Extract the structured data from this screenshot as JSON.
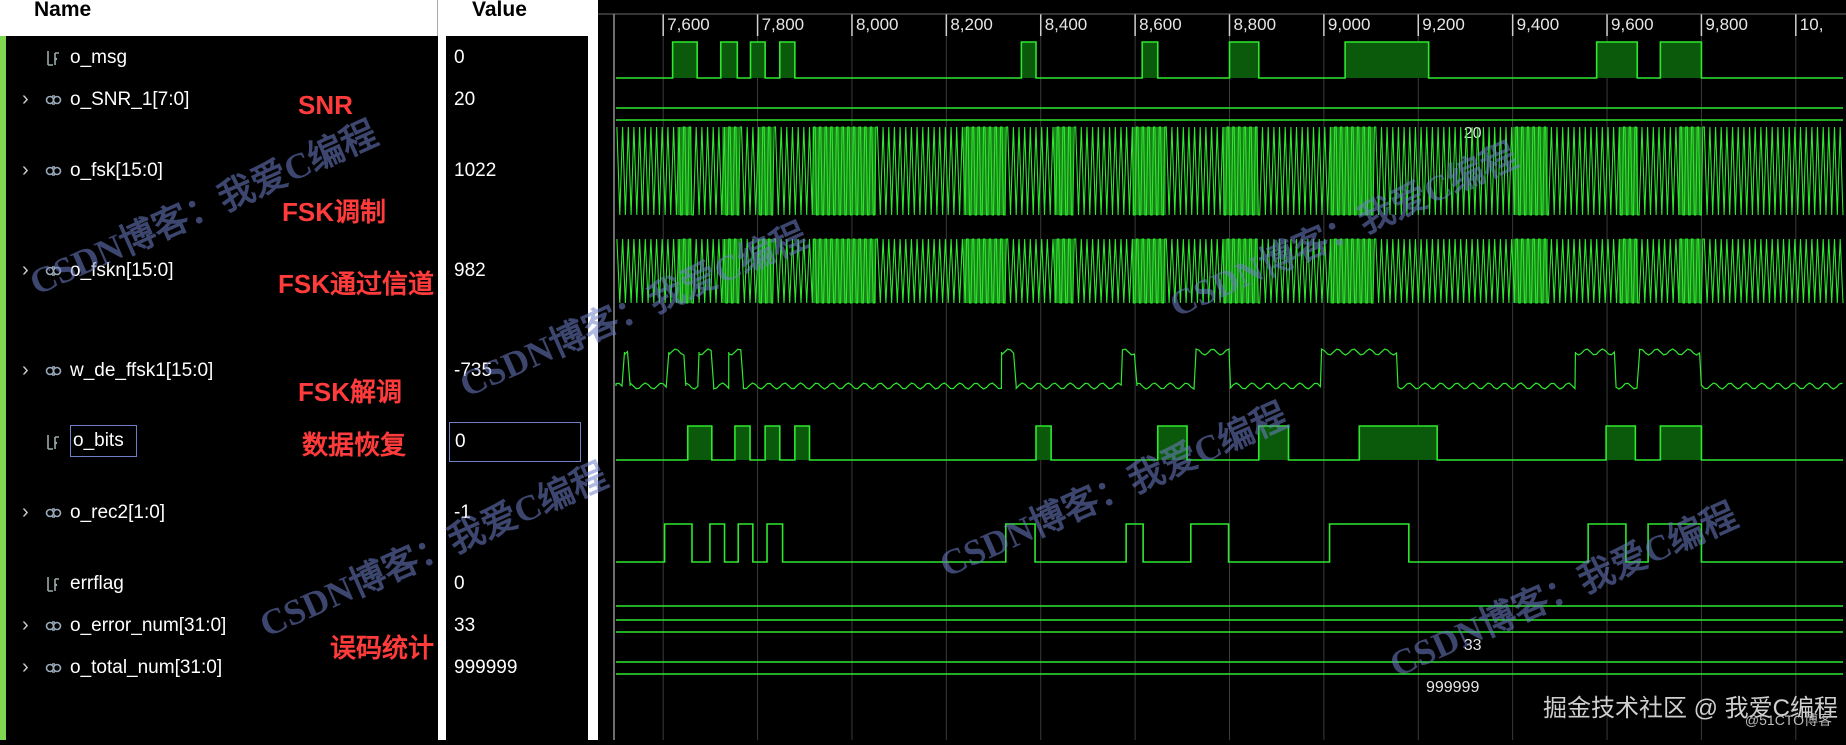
{
  "columns": {
    "name_label": "Name",
    "value_label": "Value"
  },
  "colors": {
    "wave": "#2ee82e",
    "wave_fill": "#0b5a0b",
    "grid": "#3a3a3a",
    "cursor": "#8f8f8f",
    "annotation": "#ff3b3b",
    "selection": "#6f7fc8",
    "accent": "#7fd650"
  },
  "timeline": {
    "ticks": [
      "7,600",
      "7,800",
      "8,000",
      "8,200",
      "8,400",
      "8,600",
      "8,800",
      "9,000",
      "9,200",
      "9,400",
      "9,600",
      "9,800",
      "10,"
    ],
    "range": [
      7500,
      10100
    ]
  },
  "signals": [
    {
      "name": "o_msg",
      "value": "0",
      "icon": "wire-icon",
      "expandable": false
    },
    {
      "name": "o_SNR_1[7:0]",
      "value": "20",
      "icon": "bus-icon",
      "expandable": true
    },
    {
      "name": "o_fsk[15:0]",
      "value": "1022",
      "icon": "bus-icon",
      "expandable": true
    },
    {
      "name": "o_fskn[15:0]",
      "value": "982",
      "icon": "bus-icon",
      "expandable": true
    },
    {
      "name": "w_de_ffsk1[15:0]",
      "value": "-735",
      "icon": "bus-icon",
      "expandable": true
    },
    {
      "name": "o_bits",
      "value": "0",
      "icon": "wire-icon",
      "expandable": false,
      "selected": true
    },
    {
      "name": "o_rec2[1:0]",
      "value": "-1",
      "icon": "bus-icon",
      "expandable": true
    },
    {
      "name": "errflag",
      "value": "0",
      "icon": "wire-icon",
      "expandable": false
    },
    {
      "name": "o_error_num[31:0]",
      "value": "33",
      "icon": "bus-icon",
      "expandable": true
    },
    {
      "name": "o_total_num[31:0]",
      "value": "999999",
      "icon": "bus-icon",
      "expandable": true
    }
  ],
  "bus_labels": {
    "snr": "20",
    "error_num": "33",
    "total_num": "999999"
  },
  "annotations": [
    "SNR",
    "FSK调制",
    "FSK通过信道",
    "FSK解调",
    "数据恢复",
    "误码统计"
  ],
  "watermarks": {
    "diagonal": "CSDN博客：我爱C编程",
    "bottom": "掘金技术社区 @ 我爱C编程",
    "bottom_sub": "@51CTO博客"
  },
  "waves": {
    "o_msg": [
      [
        7620,
        7672
      ],
      [
        7722,
        7757
      ],
      [
        7785,
        7816
      ],
      [
        7847,
        7879
      ],
      [
        8359,
        8390
      ],
      [
        8615,
        8648
      ],
      [
        8800,
        8862
      ],
      [
        9045,
        9222
      ],
      [
        9578,
        9664
      ],
      [
        9713,
        9800
      ]
    ],
    "o_bits": [
      [
        7652,
        7703
      ],
      [
        7752,
        7784
      ],
      [
        7816,
        7847
      ],
      [
        7879,
        7910
      ],
      [
        8390,
        8422
      ],
      [
        8648,
        8710
      ],
      [
        8862,
        8925
      ],
      [
        9075,
        9240
      ],
      [
        9598,
        9660
      ],
      [
        9713,
        9800
      ]
    ],
    "w_de_hi": [
      [
        7518,
        7530
      ],
      [
        7612,
        7648
      ],
      [
        7676,
        7707
      ],
      [
        7739,
        7770
      ],
      [
        8317,
        8348
      ],
      [
        8573,
        8604
      ],
      [
        8729,
        8802
      ],
      [
        8995,
        9157
      ],
      [
        9533,
        9619
      ],
      [
        9669,
        9800
      ]
    ],
    "o_rec2": [
      [
        7603,
        7661
      ],
      [
        7699,
        7730
      ],
      [
        7759,
        7790
      ],
      [
        7820,
        7853
      ],
      [
        8326,
        8388
      ],
      [
        8581,
        8617
      ],
      [
        8718,
        8798
      ],
      [
        9012,
        9180
      ],
      [
        9560,
        9640
      ],
      [
        9687,
        9800
      ]
    ],
    "fsk_dense": [
      [
        7630,
        7660
      ],
      [
        7725,
        7761
      ],
      [
        7801,
        7832
      ],
      [
        7916,
        8051
      ],
      [
        8236,
        8326
      ],
      [
        8428,
        8469
      ],
      [
        8594,
        8665
      ],
      [
        8786,
        8860
      ],
      [
        9012,
        9105
      ],
      [
        9401,
        9475
      ],
      [
        9625,
        9666
      ],
      [
        9752,
        9800
      ]
    ],
    "fskn_dense": [
      [
        7630,
        7660
      ],
      [
        7725,
        7761
      ],
      [
        7801,
        7832
      ],
      [
        7916,
        8051
      ],
      [
        8236,
        8326
      ],
      [
        8428,
        8469
      ],
      [
        8594,
        8665
      ],
      [
        8786,
        8860
      ],
      [
        9012,
        9105
      ],
      [
        9401,
        9475
      ],
      [
        9625,
        9666
      ],
      [
        9752,
        9800
      ]
    ]
  }
}
